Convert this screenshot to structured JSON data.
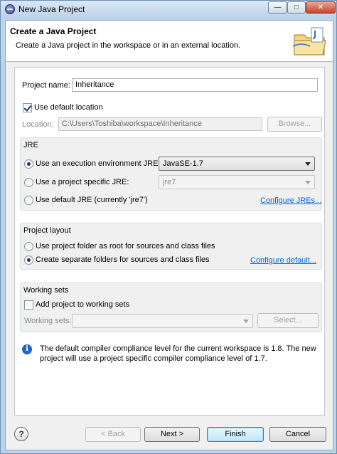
{
  "window": {
    "title": "New Java Project",
    "min_glyph": "—",
    "max_glyph": "□",
    "close_glyph": "✕"
  },
  "header": {
    "title": "Create a Java Project",
    "description": "Create a Java project in the workspace or in an external location."
  },
  "project": {
    "name_label": "Project name:",
    "name_value": "Inheritance"
  },
  "location": {
    "use_default_label": "Use default location",
    "use_default_checked": true,
    "label": "Location:",
    "value": "C:\\Users\\Toshiba\\workspace\\Inheritance",
    "browse_label": "Browse..."
  },
  "jre": {
    "group_label": "JRE",
    "env_label": "Use an execution environment JRE:",
    "env_value": "JavaSE-1.7",
    "specific_label": "Use a project specific JRE:",
    "specific_value": "jre7",
    "default_label": "Use default JRE (currently 'jre7')",
    "configure_link": "Configure JREs..."
  },
  "layout": {
    "group_label": "Project layout",
    "root_label": "Use project folder as root for sources and class files",
    "separate_label": "Create separate folders for sources and class files",
    "configure_link": "Configure default..."
  },
  "working_sets": {
    "group_label": "Working sets",
    "add_label": "Add project to working sets",
    "add_checked": false,
    "sets_label": "Working sets:",
    "select_label": "Select..."
  },
  "info": {
    "icon": "i",
    "message": "The default compiler compliance level for the current workspace is 1.8. The new project will use a project specific compiler compliance level of 1.7."
  },
  "footer": {
    "help_glyph": "?",
    "back_label": "< Back",
    "next_label": "Next >",
    "finish_label": "Finish",
    "cancel_label": "Cancel"
  }
}
